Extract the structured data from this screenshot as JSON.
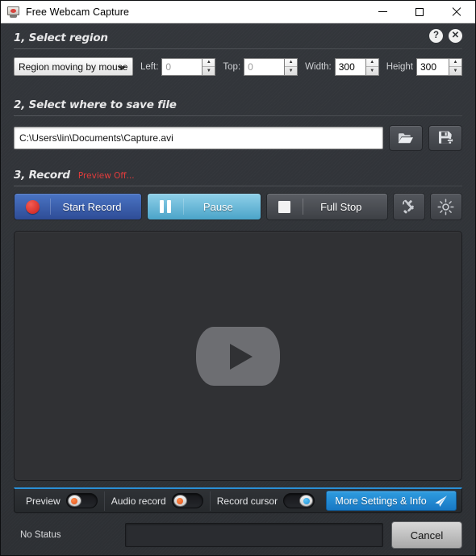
{
  "window": {
    "title": "Free Webcam Capture",
    "icon": "webcam-icon",
    "minimize_label": "Minimize",
    "maximize_label": "Maximize",
    "close_label": "Close"
  },
  "section1": {
    "title": "1, Select region",
    "help_icon": "?",
    "close_icon": "✕",
    "region_mode": "Region moving by mouse",
    "region_options": [
      "Region moving by mouse"
    ],
    "fields": {
      "left_label": "Left:",
      "left_value": "0",
      "top_label": "Top:",
      "top_value": "0",
      "width_label": "Width:",
      "width_value": "300",
      "height_label": "Height",
      "height_value": "300"
    },
    "spin_up": "▲",
    "spin_down": "▼"
  },
  "section2": {
    "title": "2, Select where to save file",
    "path_value": "C:\\Users\\lin\\Documents\\Capture.avi",
    "path_placeholder": "C:\\Users\\lin\\Documents\\Capture.avi",
    "browse_icon": "folder-open-icon",
    "saveas_icon": "save-as-icon"
  },
  "section3": {
    "title": "3, Record",
    "note": "Preview Off...",
    "start_record_label": "Start Record",
    "pause_label": "Pause",
    "full_stop_label": "Full Stop",
    "tools_icon": "tools-icon",
    "brightness_icon": "brightness-icon"
  },
  "preview": {
    "placeholder_icon": "play-button-icon"
  },
  "toggles": {
    "preview_label": "Preview",
    "preview_state": "off",
    "audio_label": "Audio record",
    "audio_state": "off",
    "cursor_label": "Record cursor",
    "cursor_state": "on",
    "more_settings_label": "More Settings & Info",
    "more_settings_icon": "send-paper-plane-icon"
  },
  "status": {
    "text": "No Status",
    "cancel_label": "Cancel"
  },
  "colors": {
    "accent_blue": "#2a8fd6",
    "record_blue": "#3a5fae",
    "pause_cyan": "#6fbcdb",
    "warning_red": "#e03c3c",
    "toggle_off": "#e2521a",
    "toggle_on": "#1f8fd4"
  }
}
